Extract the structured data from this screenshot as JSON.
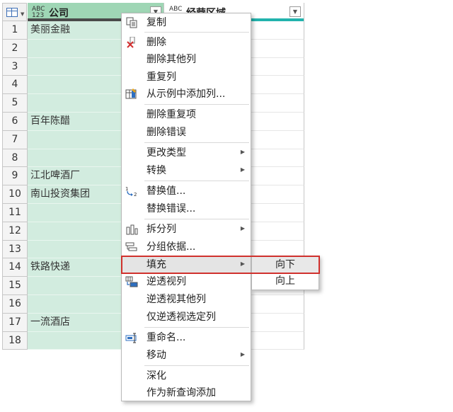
{
  "table": {
    "columns": [
      {
        "type_top": "ABC",
        "type_bottom": "123",
        "title": "公司"
      },
      {
        "type_top": "ABC",
        "title": "经营区域"
      }
    ],
    "rows": [
      {
        "num": "1",
        "company": "美丽金融"
      },
      {
        "num": "2",
        "company": ""
      },
      {
        "num": "3",
        "company": ""
      },
      {
        "num": "4",
        "company": ""
      },
      {
        "num": "5",
        "company": ""
      },
      {
        "num": "6",
        "company": "百年陈醋"
      },
      {
        "num": "7",
        "company": ""
      },
      {
        "num": "8",
        "company": ""
      },
      {
        "num": "9",
        "company": "江北啤酒厂"
      },
      {
        "num": "10",
        "company": "南山投资集团"
      },
      {
        "num": "11",
        "company": ""
      },
      {
        "num": "12",
        "company": ""
      },
      {
        "num": "13",
        "company": ""
      },
      {
        "num": "14",
        "company": "铁路快递"
      },
      {
        "num": "15",
        "company": ""
      },
      {
        "num": "16",
        "company": ""
      },
      {
        "num": "17",
        "company": "一流酒店"
      },
      {
        "num": "18",
        "company": ""
      }
    ]
  },
  "menu": {
    "copy": "复制",
    "remove": "删除",
    "remove_other_columns": "删除其他列",
    "duplicate_column": "重复列",
    "add_column_from_examples": "从示例中添加列...",
    "remove_duplicates": "删除重复项",
    "remove_errors": "删除错误",
    "change_type": "更改类型",
    "transform": "转换",
    "replace_values": "替换值...",
    "replace_errors": "替换错误...",
    "split_column": "拆分列",
    "group_by": "分组依据...",
    "fill": "填充",
    "unpivot_columns": "逆透视列",
    "unpivot_other_columns": "逆透视其他列",
    "unpivot_selected_columns": "仅逆透视选定列",
    "rename": "重命名...",
    "move": "移动",
    "drill_down": "深化",
    "add_as_new_query": "作为新查询添加"
  },
  "submenu": {
    "down": "向下",
    "up": "向上"
  },
  "colors": {
    "selected_column": "#d2ecdf",
    "selected_header": "#9fd6b5",
    "column_quality_bar": "#22b3ad",
    "highlight_box": "#d0312d"
  }
}
